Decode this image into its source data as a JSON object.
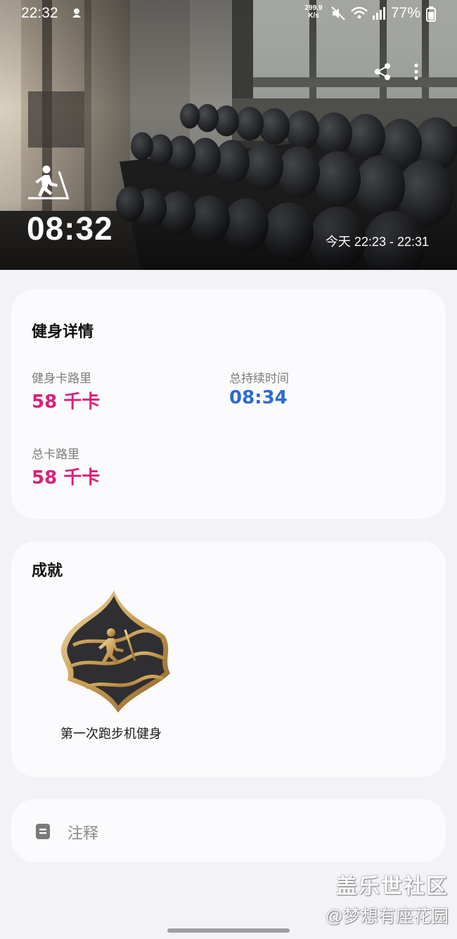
{
  "status_bar": {
    "time": "22:32",
    "net_speed_value": "299.9",
    "net_speed_unit": "K/s",
    "battery": "77%"
  },
  "hero": {
    "duration": "08:32",
    "date_range": "今天 22:23 - 22:31",
    "activity_icon": "treadmill-icon"
  },
  "details": {
    "title": "健身详情",
    "metrics": [
      {
        "label": "健身卡路里",
        "value": "58 千卡",
        "color": "#d6217a"
      },
      {
        "label": "总持续时间",
        "value": "08:34",
        "color": "#2d6ad3"
      },
      {
        "label": "总卡路里",
        "value": "58 千卡",
        "color": "#d6217a"
      }
    ]
  },
  "achievements": {
    "title": "成就",
    "badge": {
      "label": "第一次跑步机健身",
      "icon": "treadmill-badge-icon"
    }
  },
  "notes": {
    "label": "注释",
    "icon": "note-icon"
  },
  "watermark": {
    "line1": "盖乐世社区",
    "line2": "@梦想有座花园"
  },
  "colors": {
    "calorie": "#d6217a",
    "duration": "#2d6ad3",
    "background": "#f3f2f7",
    "card": "#fbfbfd"
  }
}
